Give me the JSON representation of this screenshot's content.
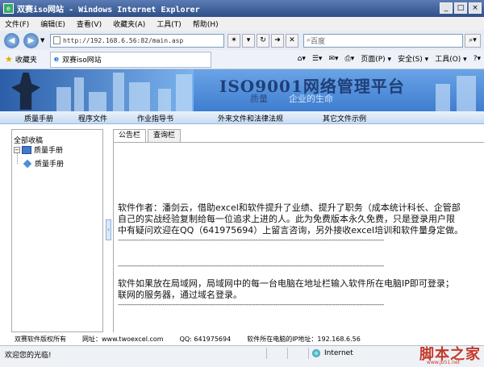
{
  "window": {
    "title": "双赛iso网站 - Windows Internet Explorer"
  },
  "menu": [
    "文件(F)",
    "编辑(E)",
    "查看(V)",
    "收藏夹(A)",
    "工具(T)",
    "帮助(H)"
  ],
  "address": {
    "url": "http://192.168.6.56:82/main.asp",
    "search_placeholder": "百度"
  },
  "favorites": {
    "label": "收藏夹",
    "tab": "双赛iso网站"
  },
  "commands": [
    "页面(P) ▾",
    "安全(S) ▾",
    "工具(O) ▾"
  ],
  "banner": {
    "title": "ISO9001网络管理平台",
    "sub1": "质量",
    "sub2": "企业的生命"
  },
  "nav": [
    "质量手册",
    "程序文件",
    "作业指导书",
    "外来文件和法律法规",
    "其它文件示例"
  ],
  "sidebar": {
    "root": "全部收稿",
    "folder": "质量手册",
    "leaf": "质量手册"
  },
  "tabs": [
    "公告栏",
    "查询栏"
  ],
  "content": {
    "p1_l1": "软件作者：潘剑云，借助excel和软件提升了业绩、提升了职务（成本统计科长、企管部",
    "p1_l2": "自己的实战经验复制给每一位追求上进的人。此为免费版本永久免费，只是登录用户限",
    "p1_l3": "中有疑问欢迎在QQ（641975694）上留言咨询，另外接收excel培训和软件量身定做。",
    "sep": "------------------------------------------------------------------------------------------------------------------------",
    "p2_l1": "软件如果放在局域网，局域网中的每一台电脑在地址栏输入软件所在电脑IP即可登录；",
    "p2_l2": "联网的服务器，通过域名登录。"
  },
  "footer": {
    "copyright": "双赛软件版权所有",
    "site": "网址：www.twoexcel.com",
    "qq": "QQ: 641975694",
    "ip": "软件所在电脑的IP地址：192.168.6.56"
  },
  "status": {
    "text": "欢迎您的光临!",
    "zone": "Internet"
  },
  "watermark": {
    "main": "脚本之家",
    "sub": "www.jb51.net"
  }
}
